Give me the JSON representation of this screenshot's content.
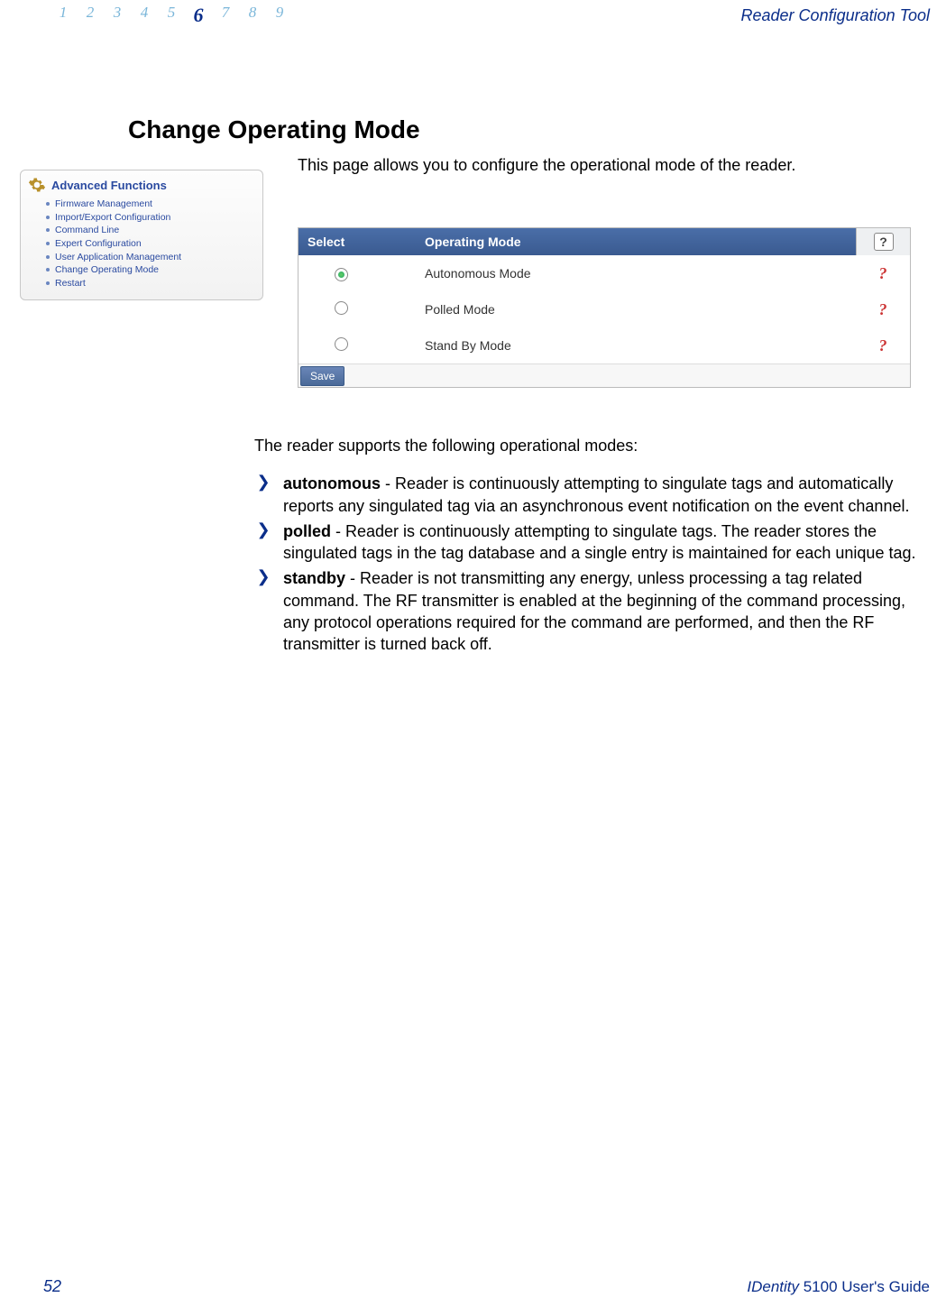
{
  "header": {
    "tabs": [
      "1",
      "2",
      "3",
      "4",
      "5",
      "6",
      "7",
      "8",
      "9"
    ],
    "active_index": 5,
    "title": "Reader Configuration Tool"
  },
  "page": {
    "title": "Change Operating Mode",
    "intro": "This page allows you to configure the operational mode of the reader."
  },
  "sidebar": {
    "title": "Advanced Functions",
    "items": [
      "Firmware Management",
      "Import/Export Configuration",
      "Command Line",
      "Expert Configuration",
      "User Application Management",
      "Change Operating Mode",
      "Restart"
    ]
  },
  "mode_table": {
    "col_select": "Select",
    "col_mode": "Operating Mode",
    "help_head": "?",
    "rows": [
      {
        "label": "Autonomous Mode",
        "selected": true,
        "help": "?"
      },
      {
        "label": "Polled Mode",
        "selected": false,
        "help": "?"
      },
      {
        "label": "Stand By Mode",
        "selected": false,
        "help": "?"
      }
    ],
    "save": "Save"
  },
  "modes_intro": "The reader supports the following operational modes:",
  "modes": [
    {
      "lead": "autonomous",
      "rest": " - Reader is continuously attempting to singulate tags and automatically reports any singulated tag via an asynchronous event notification on the event channel."
    },
    {
      "lead": "polled",
      "rest": " - Reader is continuously attempting to singulate tags.  The reader stores the singulated tags in the tag database and a single entry is maintained for each unique tag."
    },
    {
      "lead": "standby",
      "rest": " - Reader is not transmitting any energy, unless processing a tag related command. The RF transmitter is enabled at the beginning of the command processing, any protocol operations required for the command are performed, and then the RF transmitter is turned back off."
    }
  ],
  "footer": {
    "page": "52",
    "brand": "IDentity",
    "rest": " 5100 User's Guide"
  }
}
